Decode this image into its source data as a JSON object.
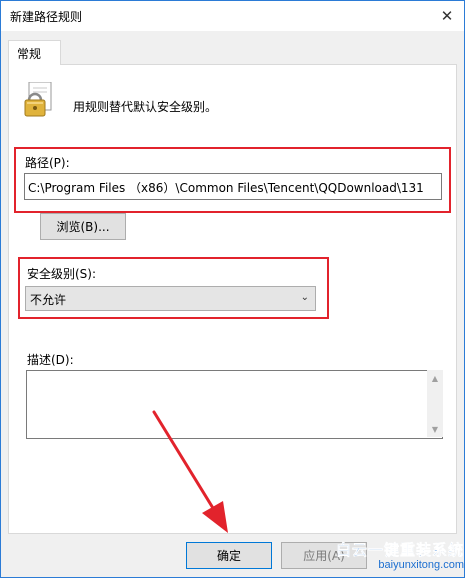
{
  "window": {
    "title": "新建路径规则",
    "close_glyph": "✕"
  },
  "tabs": [
    {
      "label": "常规"
    }
  ],
  "general": {
    "icon": "lock-icon",
    "description": "用规则替代默认安全级别。",
    "path_label": "路径(P):",
    "path_value": "C:\\Program Files （x86）\\Common Files\\Tencent\\QQDownload\\131",
    "browse_label": "浏览(B)...",
    "security_level_label": "安全级别(S):",
    "security_level_value": "不允许",
    "description_label": "描述(D):",
    "description_value": ""
  },
  "buttons": {
    "ok_label": "确定",
    "apply_label": "应用(A)"
  },
  "watermark": {
    "line1": "白云一键重装系统",
    "line2": "baiyunxitong.com"
  },
  "colors": {
    "highlight_red": "#e2232c",
    "window_border": "#2b7bd6",
    "ok_border": "#0078d7"
  }
}
